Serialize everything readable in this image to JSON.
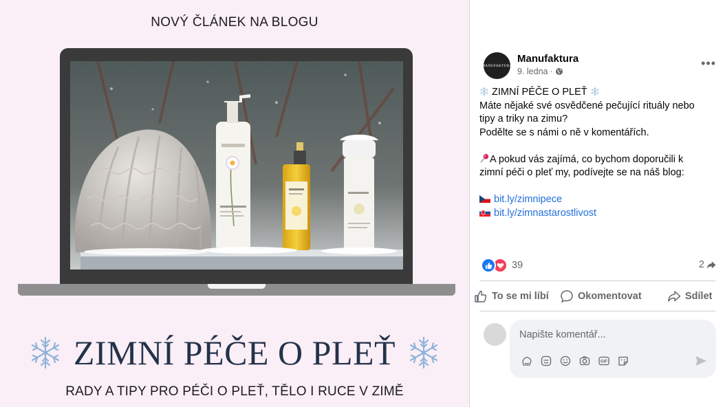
{
  "promo": {
    "heading": "NOVÝ ČLÁNEK NA BLOGU",
    "title": "ZIMNÍ PÉČE O PLEŤ",
    "subtitle": "RADY A TIPY PRO PÉČI O PLEŤ, TĚLO I RUCE V ZIMĚ",
    "bottle_brand": "MANUFAKTURA"
  },
  "post": {
    "avatar_text": "MANUFAKTURA",
    "page_name": "Manufaktura",
    "date": "9. ledna",
    "date_separator": "·",
    "more_label": "•••",
    "body": {
      "title": "ZIMNÍ PÉČE O PLEŤ",
      "line1": "Máte nějaké své osvědčené pečující rituály nebo",
      "line2": "tipy a triky na zimu?",
      "line3": "Podělte se s námi o ně v komentářích.",
      "line4": "A pokud vás zajímá, co bychom doporučili k",
      "line5": "zimní péči o pleť my, podívejte se na náš blog:",
      "link_cz": "bit.ly/zimnipece",
      "link_sk": "bit.ly/zimnastarostlivost"
    },
    "reactions_count": "39",
    "shares_count": "2",
    "actions": {
      "like": "To se mi líbí",
      "comment": "Okomentovat",
      "share": "Sdílet"
    },
    "comment_placeholder": "Napište komentář..."
  },
  "colors": {
    "promo_bg": "#faeef7",
    "title_color": "#233349",
    "link_color": "#216fdb",
    "like_blue": "#1877f2",
    "love_red": "#f33e58"
  }
}
